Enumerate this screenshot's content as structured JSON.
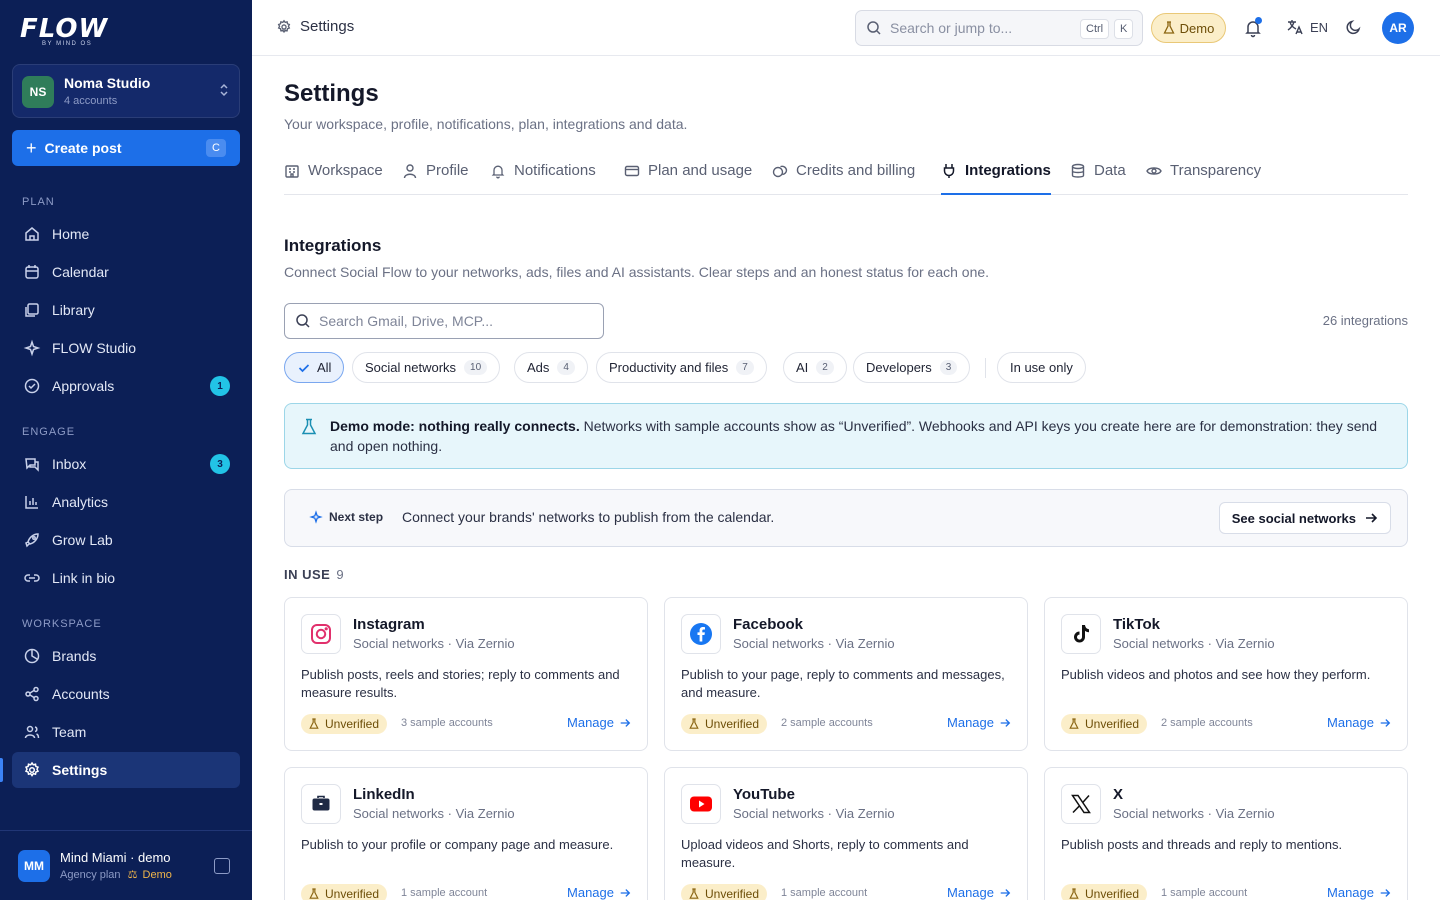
{
  "brand": {
    "logo": "FLOW",
    "logo_sub": "BY MIND OS"
  },
  "workspace": {
    "initials": "NS",
    "name": "Noma Studio",
    "accounts": "4 accounts"
  },
  "create": {
    "label": "Create post",
    "shortcut": "C"
  },
  "nav": {
    "plan_label": "PLAN",
    "engage_label": "ENGAGE",
    "workspace_label": "WORKSPACE",
    "items": [
      {
        "label": "Home",
        "icon": "home-icon"
      },
      {
        "label": "Calendar",
        "icon": "calendar-icon"
      },
      {
        "label": "Library",
        "icon": "library-icon"
      },
      {
        "label": "FLOW Studio",
        "icon": "sparkles-icon"
      },
      {
        "label": "Approvals",
        "icon": "check-circle-icon",
        "badge": "1"
      },
      {
        "label": "Inbox",
        "icon": "inbox-icon",
        "badge": "3"
      },
      {
        "label": "Analytics",
        "icon": "bar-chart-icon"
      },
      {
        "label": "Grow Lab",
        "icon": "rocket-icon"
      },
      {
        "label": "Link in bio",
        "icon": "link-icon"
      },
      {
        "label": "Brands",
        "icon": "brands-icon"
      },
      {
        "label": "Accounts",
        "icon": "share-icon"
      },
      {
        "label": "Team",
        "icon": "users-icon"
      },
      {
        "label": "Settings",
        "icon": "gear-icon",
        "active": true
      }
    ]
  },
  "user": {
    "initials": "MM",
    "name": "Mind Miami · demo",
    "plan": "Agency plan",
    "demo": "Demo"
  },
  "topbar": {
    "title": "Settings",
    "search_placeholder": "Search or jump to...",
    "kbd_ctrl": "Ctrl",
    "kbd_k": "K",
    "demo": "Demo",
    "lang": "EN",
    "avatar": "AR",
    "accent": "#1d6fe8"
  },
  "page": {
    "title": "Settings",
    "subtitle": "Your workspace, profile, notifications, plan, integrations and data."
  },
  "tabs": [
    {
      "label": "Workspace",
      "icon": "building-icon"
    },
    {
      "label": "Profile",
      "icon": "user-icon"
    },
    {
      "label": "Notifications",
      "icon": "bell-icon"
    },
    {
      "label": "Plan and usage",
      "icon": "card-icon"
    },
    {
      "label": "Credits and billing",
      "icon": "coins-icon"
    },
    {
      "label": "Integrations",
      "icon": "plug-icon",
      "active": true
    },
    {
      "label": "Data",
      "icon": "database-icon"
    },
    {
      "label": "Transparency",
      "icon": "eye-icon"
    }
  ],
  "integrations": {
    "title": "Integrations",
    "subtitle": "Connect Social Flow to your networks, ads, files and AI assistants. Clear steps and an honest status for each one.",
    "search_placeholder": "Search Gmail, Drive, MCP...",
    "count": "26 integrations",
    "filters": [
      {
        "label": "All",
        "active": true
      },
      {
        "label": "Social networks",
        "count": "10"
      },
      {
        "label": "Ads",
        "count": "4"
      },
      {
        "label": "Productivity and files",
        "count": "7"
      },
      {
        "label": "AI",
        "count": "2"
      },
      {
        "label": "Developers",
        "count": "3"
      },
      {
        "label": "In use only"
      }
    ],
    "banner_bold": "Demo mode: nothing really connects.",
    "banner_text": " Networks with sample accounts show as “Unverified”. Webhooks and API keys you create here are for demonstration: they send and open nothing.",
    "next_label": "Next step",
    "next_text": "Connect your brands' networks to publish from the calendar.",
    "next_button": "See social networks",
    "in_use_label": "IN USE",
    "in_use_count": "9",
    "cards": [
      {
        "name": "Instagram",
        "cat": "Social networks · Via Zernio",
        "desc": "Publish posts, reels and stories; reply to comments and measure results.",
        "status": "Unverified",
        "accounts": "3 sample accounts",
        "manage": "Manage",
        "icon": "instagram-icon"
      },
      {
        "name": "Facebook",
        "cat": "Social networks · Via Zernio",
        "desc": "Publish to your page, reply to comments and messages, and measure.",
        "status": "Unverified",
        "accounts": "2 sample accounts",
        "manage": "Manage",
        "icon": "facebook-icon"
      },
      {
        "name": "TikTok",
        "cat": "Social networks · Via Zernio",
        "desc": "Publish videos and photos and see how they perform.",
        "status": "Unverified",
        "accounts": "2 sample accounts",
        "manage": "Manage",
        "icon": "tiktok-icon"
      },
      {
        "name": "LinkedIn",
        "cat": "Social networks · Via Zernio",
        "desc": "Publish to your profile or company page and measure.",
        "status": "Unverified",
        "accounts": "1 sample account",
        "manage": "Manage",
        "icon": "briefcase-icon"
      },
      {
        "name": "YouTube",
        "cat": "Social networks · Via Zernio",
        "desc": "Upload videos and Shorts, reply to comments and measure.",
        "status": "Unverified",
        "accounts": "1 sample account",
        "manage": "Manage",
        "icon": "youtube-icon"
      },
      {
        "name": "X",
        "cat": "Social networks · Via Zernio",
        "desc": "Publish posts and threads and reply to mentions.",
        "status": "Unverified",
        "accounts": "1 sample account",
        "manage": "Manage",
        "icon": "x-icon"
      }
    ]
  }
}
